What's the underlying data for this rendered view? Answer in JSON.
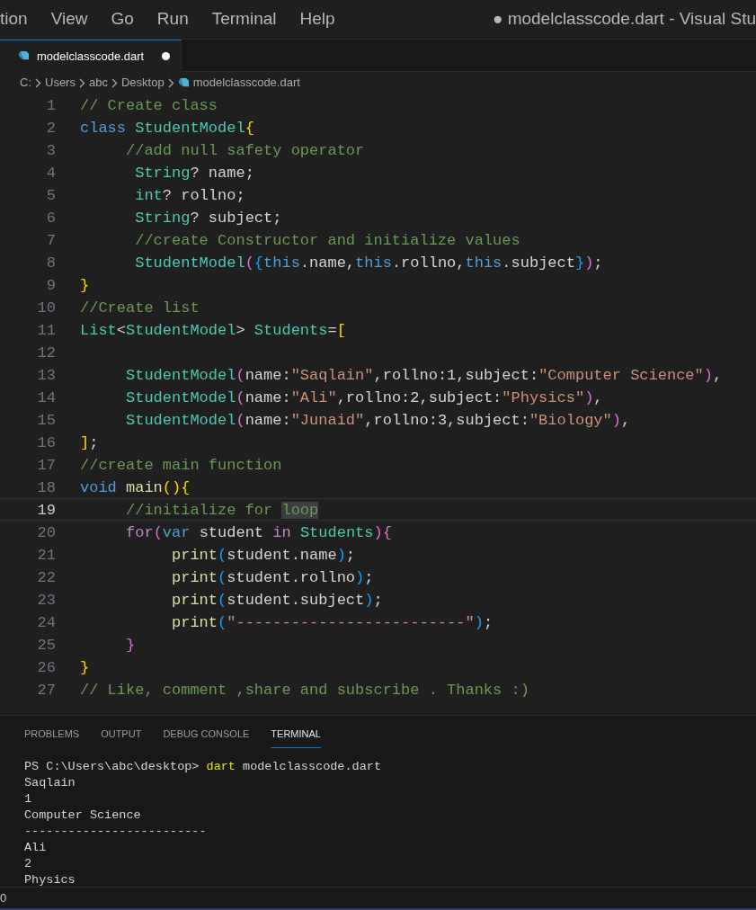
{
  "menu_bar": {
    "items": [
      "tion",
      "View",
      "Go",
      "Run",
      "Terminal",
      "Help"
    ],
    "title": "● modelclasscode.dart - Visual Stu"
  },
  "tabs": [
    {
      "label": "modelclasscode.dart",
      "selected": true,
      "modified": true
    }
  ],
  "breadcrumb": [
    {
      "label": "C:",
      "kind": "folder"
    },
    {
      "label": "Users",
      "kind": "folder"
    },
    {
      "label": "abc",
      "kind": "folder"
    },
    {
      "label": "Desktop",
      "kind": "folder"
    },
    {
      "label": "modelclasscode.dart",
      "kind": "file"
    }
  ],
  "editor": {
    "lines": [
      {
        "number": "1",
        "current": false,
        "tokens": [
          {
            "text": "// Create class",
            "kind": "cm"
          }
        ]
      },
      {
        "number": "2",
        "current": false,
        "tokens": [
          {
            "text": "class ",
            "kind": "kw"
          },
          {
            "text": "StudentModel",
            "kind": "type"
          },
          {
            "text": "{",
            "kind": "b1"
          }
        ]
      },
      {
        "number": "3",
        "current": false,
        "tokens": [
          {
            "text": "     //add null safety operator",
            "kind": "cm"
          }
        ]
      },
      {
        "number": "4",
        "current": false,
        "tokens": [
          {
            "text": "      String",
            "kind": "type"
          },
          {
            "text": "? name;",
            "kind": "pl"
          }
        ]
      },
      {
        "number": "5",
        "current": false,
        "tokens": [
          {
            "text": "      int",
            "kind": "type"
          },
          {
            "text": "? rollno;",
            "kind": "pl"
          }
        ]
      },
      {
        "number": "6",
        "current": false,
        "tokens": [
          {
            "text": "      String",
            "kind": "type"
          },
          {
            "text": "? subject;",
            "kind": "pl"
          }
        ]
      },
      {
        "number": "7",
        "current": false,
        "tokens": [
          {
            "text": "      //create Constructor and initialize values",
            "kind": "cm"
          }
        ]
      },
      {
        "number": "8",
        "current": false,
        "tokens": [
          {
            "text": "      StudentModel",
            "kind": "type"
          },
          {
            "text": "(",
            "kind": "b2"
          },
          {
            "text": "{",
            "kind": "b3"
          },
          {
            "text": "this",
            "kind": "kw"
          },
          {
            "text": ".name,",
            "kind": "pl"
          },
          {
            "text": "this",
            "kind": "kw"
          },
          {
            "text": ".rollno,",
            "kind": "pl"
          },
          {
            "text": "this",
            "kind": "kw"
          },
          {
            "text": ".subject",
            "kind": "pl"
          },
          {
            "text": "}",
            "kind": "b3"
          },
          {
            "text": ")",
            "kind": "b2"
          },
          {
            "text": ";",
            "kind": "pl"
          }
        ]
      },
      {
        "number": "9",
        "current": false,
        "tokens": [
          {
            "text": "}",
            "kind": "b1"
          }
        ]
      },
      {
        "number": "10",
        "current": false,
        "tokens": [
          {
            "text": "//Create list",
            "kind": "cm"
          }
        ]
      },
      {
        "number": "11",
        "current": false,
        "tokens": [
          {
            "text": "List",
            "kind": "type"
          },
          {
            "text": "<",
            "kind": "pl"
          },
          {
            "text": "StudentModel",
            "kind": "type"
          },
          {
            "text": "> ",
            "kind": "pl"
          },
          {
            "text": "Students",
            "kind": "type"
          },
          {
            "text": "=",
            "kind": "pl"
          },
          {
            "text": "[",
            "kind": "b1"
          }
        ]
      },
      {
        "number": "12",
        "current": false
      },
      {
        "number": "13",
        "current": false,
        "tokens": [
          {
            "text": "     StudentModel",
            "kind": "type"
          },
          {
            "text": "(",
            "kind": "b2"
          },
          {
            "text": "name:",
            "kind": "pl"
          },
          {
            "text": "\"Saqlain\"",
            "kind": "str"
          },
          {
            "text": ",rollno:1,subject:",
            "kind": "pl"
          },
          {
            "text": "\"Computer Science\"",
            "kind": "str"
          },
          {
            "text": ")",
            "kind": "b2"
          },
          {
            "text": ",",
            "kind": "pl"
          }
        ]
      },
      {
        "number": "14",
        "current": false,
        "tokens": [
          {
            "text": "     StudentModel",
            "kind": "type"
          },
          {
            "text": "(",
            "kind": "b2"
          },
          {
            "text": "name:",
            "kind": "pl"
          },
          {
            "text": "\"Ali\"",
            "kind": "str"
          },
          {
            "text": ",rollno:2,subject:",
            "kind": "pl"
          },
          {
            "text": "\"Physics\"",
            "kind": "str"
          },
          {
            "text": ")",
            "kind": "b2"
          },
          {
            "text": ",",
            "kind": "pl"
          }
        ]
      },
      {
        "number": "15",
        "current": false,
        "tokens": [
          {
            "text": "     StudentModel",
            "kind": "type"
          },
          {
            "text": "(",
            "kind": "b2"
          },
          {
            "text": "name:",
            "kind": "pl"
          },
          {
            "text": "\"Junaid\"",
            "kind": "str"
          },
          {
            "text": ",rollno:3,subject:",
            "kind": "pl"
          },
          {
            "text": "\"Biology\"",
            "kind": "str"
          },
          {
            "text": ")",
            "kind": "b2"
          },
          {
            "text": ",",
            "kind": "pl"
          }
        ]
      },
      {
        "number": "16",
        "current": false,
        "tokens": [
          {
            "text": "]",
            "kind": "b1"
          },
          {
            "text": ";",
            "kind": "pl"
          }
        ]
      },
      {
        "number": "17",
        "current": false,
        "tokens": [
          {
            "text": "//create main function",
            "kind": "cm"
          }
        ]
      },
      {
        "number": "18",
        "current": false,
        "tokens": [
          {
            "text": "void ",
            "kind": "kw"
          },
          {
            "text": "main",
            "kind": "fn"
          },
          {
            "text": "(){",
            "kind": "b1"
          }
        ]
      },
      {
        "number": "19",
        "current": true,
        "tokens": [
          {
            "text": "     //initialize for ",
            "kind": "cm"
          },
          {
            "text": "loop",
            "kind": "cm",
            "highlighted": true
          }
        ]
      },
      {
        "number": "20",
        "current": false,
        "tokens": [
          {
            "text": "     for",
            "kind": "ctl"
          },
          {
            "text": "(",
            "kind": "b2"
          },
          {
            "text": "var ",
            "kind": "kw"
          },
          {
            "text": "student ",
            "kind": "pl"
          },
          {
            "text": "in ",
            "kind": "ctl"
          },
          {
            "text": "Students",
            "kind": "type"
          },
          {
            "text": "){",
            "kind": "b2"
          }
        ]
      },
      {
        "number": "21",
        "current": false,
        "tokens": [
          {
            "text": "          print",
            "kind": "fn"
          },
          {
            "text": "(",
            "kind": "b3"
          },
          {
            "text": "student.name",
            "kind": "pl"
          },
          {
            "text": ")",
            "kind": "b3"
          },
          {
            "text": ";",
            "kind": "pl"
          }
        ]
      },
      {
        "number": "22",
        "current": false,
        "tokens": [
          {
            "text": "          print",
            "kind": "fn"
          },
          {
            "text": "(",
            "kind": "b3"
          },
          {
            "text": "student.rollno",
            "kind": "pl"
          },
          {
            "text": ")",
            "kind": "b3"
          },
          {
            "text": ";",
            "kind": "pl"
          }
        ]
      },
      {
        "number": "23",
        "current": false,
        "tokens": [
          {
            "text": "          print",
            "kind": "fn"
          },
          {
            "text": "(",
            "kind": "b3"
          },
          {
            "text": "student.subject",
            "kind": "pl"
          },
          {
            "text": ")",
            "kind": "b3"
          },
          {
            "text": ";",
            "kind": "pl"
          }
        ]
      },
      {
        "number": "24",
        "current": false,
        "tokens": [
          {
            "text": "          print",
            "kind": "fn"
          },
          {
            "text": "(",
            "kind": "b3"
          },
          {
            "text": "\"-------------------------\"",
            "kind": "str"
          },
          {
            "text": ")",
            "kind": "b3"
          },
          {
            "text": ";",
            "kind": "pl"
          }
        ]
      },
      {
        "number": "25",
        "current": false,
        "tokens": [
          {
            "text": "     }",
            "kind": "b2"
          }
        ]
      },
      {
        "number": "26",
        "current": false,
        "tokens": [
          {
            "text": "}",
            "kind": "b1"
          }
        ]
      },
      {
        "number": "27",
        "current": false,
        "tokens": [
          {
            "text": "// Like, comment ,share and subscribe . Thanks :)",
            "kind": "cm"
          }
        ]
      }
    ]
  },
  "panel": {
    "tabs": [
      {
        "label": "PROBLEMS",
        "selected": false
      },
      {
        "label": "OUTPUT",
        "selected": false
      },
      {
        "label": "DEBUG CONSOLE",
        "selected": false
      },
      {
        "label": "TERMINAL",
        "selected": true
      }
    ],
    "terminal_lines": [
      [
        {
          "text": "PS C:\\Users\\abc\\desktop> ",
          "kind": "pl"
        },
        {
          "text": "dart",
          "kind": "cmd"
        },
        {
          "text": " modelclasscode.dart",
          "kind": "pl"
        }
      ],
      [
        {
          "text": "Saqlain",
          "kind": "pl"
        }
      ],
      [
        {
          "text": "1",
          "kind": "pl"
        }
      ],
      [
        {
          "text": "Computer Science",
          "kind": "pl"
        }
      ],
      [
        {
          "text": "-------------------------",
          "kind": "pl"
        }
      ],
      [
        {
          "text": "Ali",
          "kind": "pl"
        }
      ],
      [
        {
          "text": "2",
          "kind": "pl"
        }
      ],
      [
        {
          "text": "Physics",
          "kind": "pl"
        }
      ]
    ]
  },
  "status_bar": {
    "text": "0"
  }
}
